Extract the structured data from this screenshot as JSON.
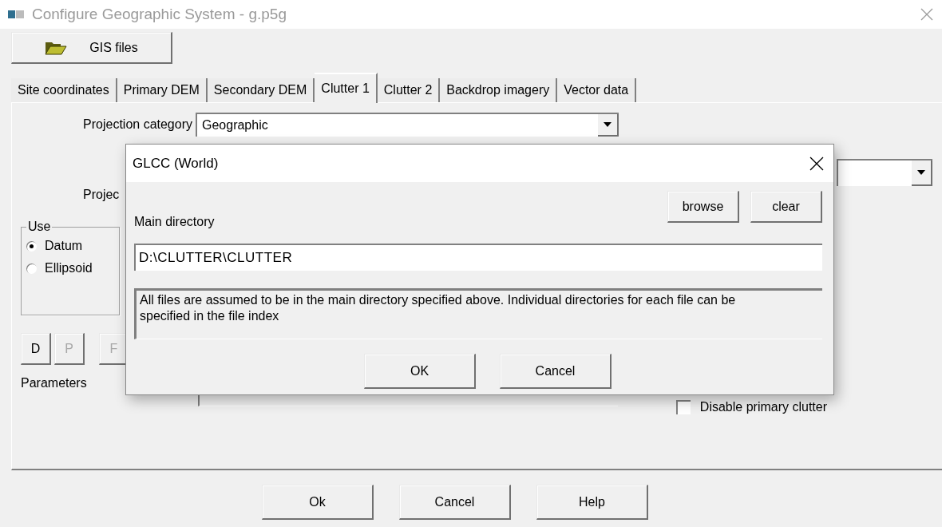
{
  "window": {
    "title": "Configure Geographic System - g.p5g"
  },
  "toolbar": {
    "gis_files_button": "GIS files"
  },
  "tabs": [
    {
      "label": "Site coordinates",
      "selected": false
    },
    {
      "label": "Primary DEM",
      "selected": false
    },
    {
      "label": "Secondary DEM",
      "selected": false
    },
    {
      "label": "Clutter 1",
      "selected": true
    },
    {
      "label": "Clutter 2",
      "selected": false
    },
    {
      "label": "Backdrop imagery",
      "selected": false
    },
    {
      "label": "Vector data",
      "selected": false
    }
  ],
  "panel": {
    "projection_category": {
      "label": "Projection category",
      "value": "Geographic"
    },
    "projection_label": "Projec",
    "use_group": {
      "title": "Use",
      "options": [
        {
          "label": "Datum",
          "selected": true
        },
        {
          "label": "Ellipsoid",
          "selected": false
        }
      ]
    },
    "param_buttons": [
      {
        "label": "D",
        "disabled": false
      },
      {
        "label": "P",
        "disabled": true
      },
      {
        "label": "F",
        "disabled": true
      }
    ],
    "parameters_label": "Parameters",
    "disable_primary_clutter": {
      "label": "Disable primary clutter",
      "checked": false
    }
  },
  "dialog": {
    "title": "GLCC (World)",
    "main_directory_label": "Main directory",
    "browse_button": "browse",
    "clear_button": "clear",
    "directory": "D:\\CLUTTER\\CLUTTER",
    "info": "All files are assumed to be in the main directory specified above. Individual directories for each file can be specified in the file index",
    "buttons": [
      "OK",
      "Cancel"
    ]
  },
  "footer_buttons": [
    "Ok",
    "Cancel",
    "Help"
  ]
}
